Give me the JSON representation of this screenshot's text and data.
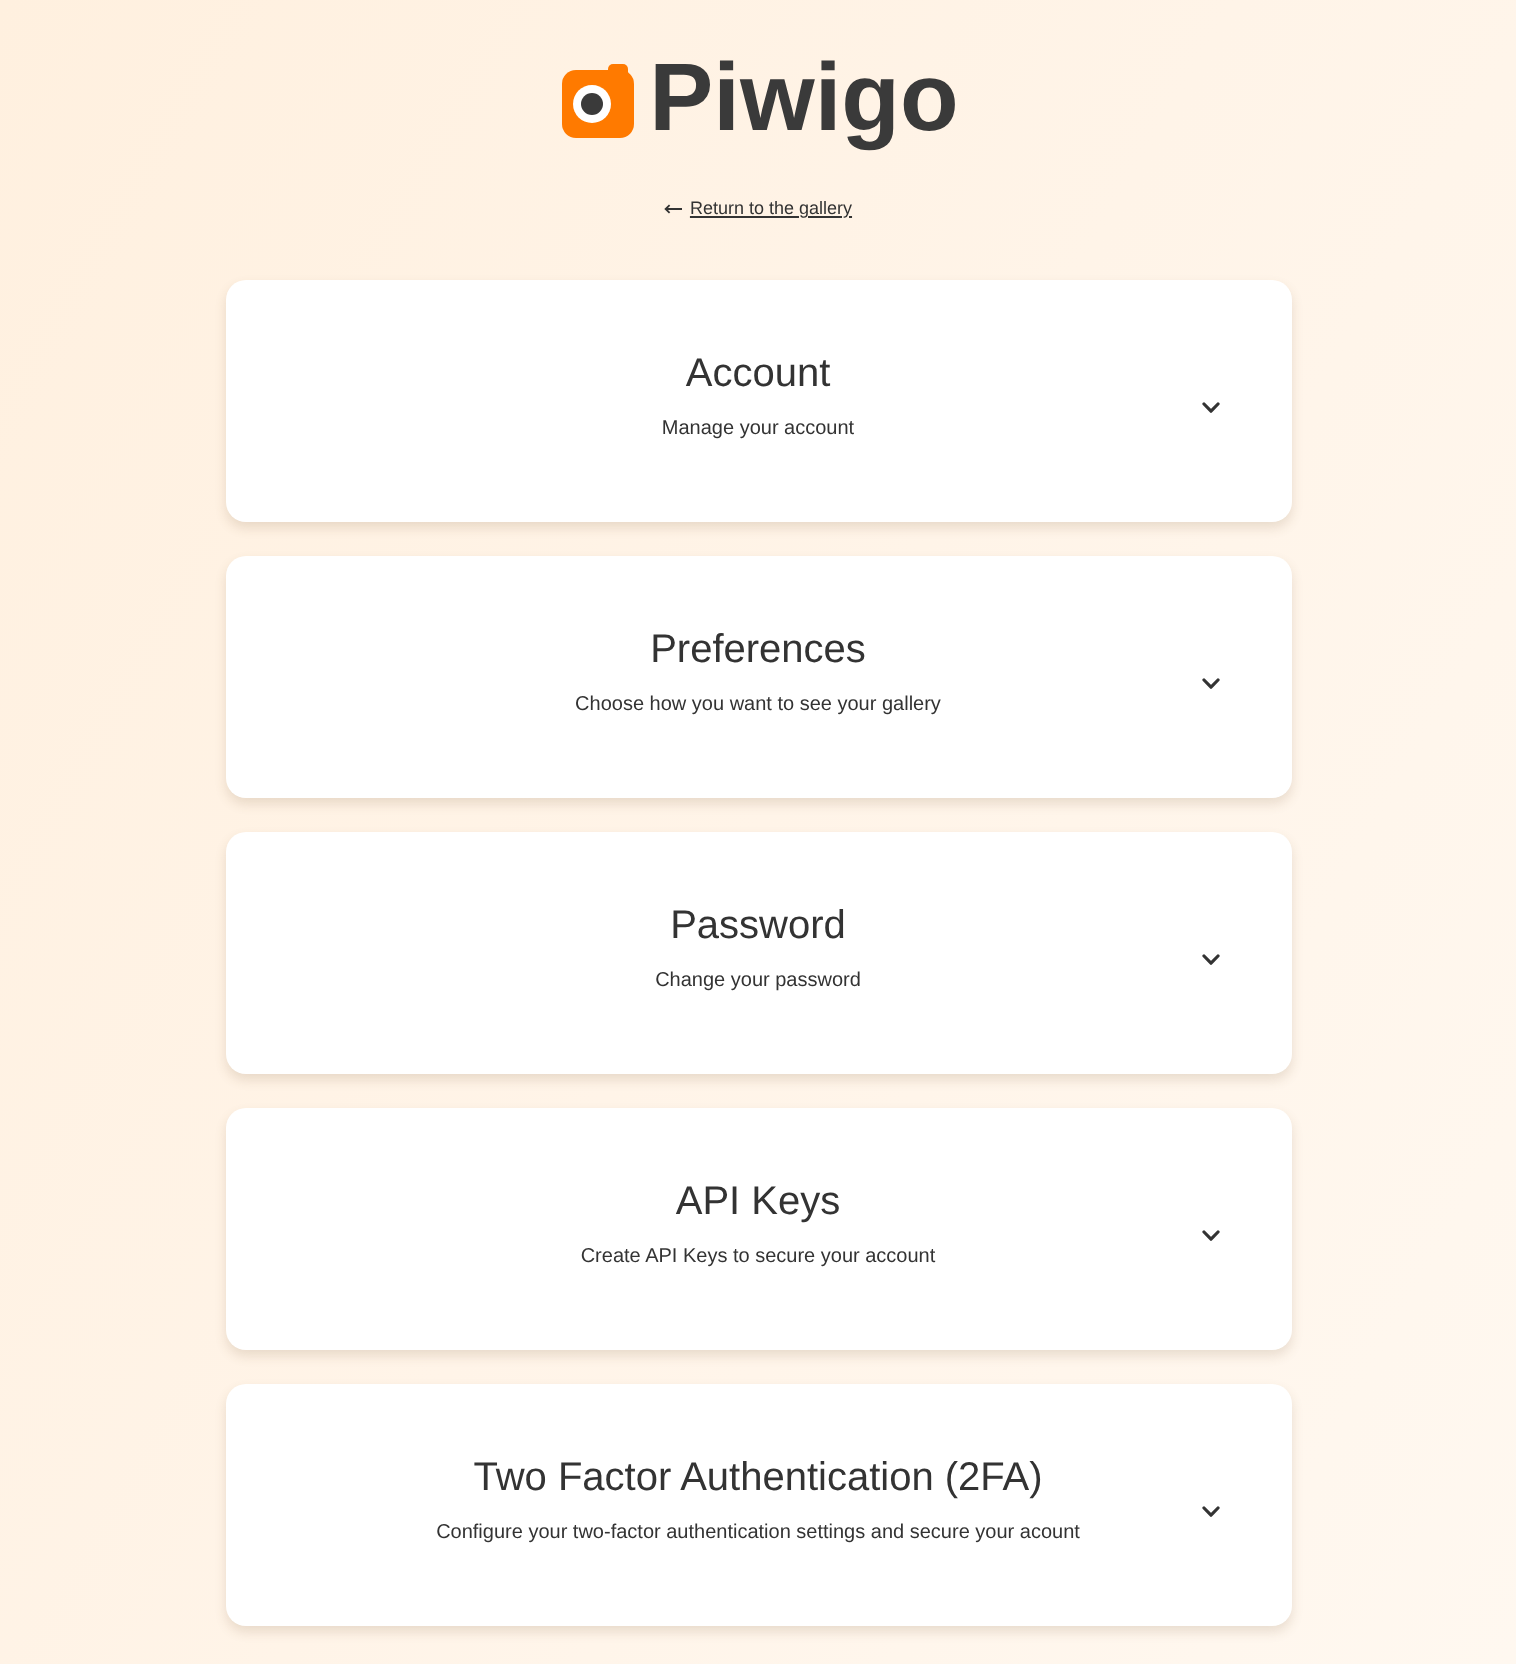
{
  "logo": {
    "text": "Piwigo"
  },
  "back_link": {
    "label": "Return to the gallery"
  },
  "sections": [
    {
      "title": "Account",
      "subtitle": "Manage your account",
      "expanded": false
    },
    {
      "title": "Preferences",
      "subtitle": "Choose how you want to see your gallery",
      "expanded": false
    },
    {
      "title": "Password",
      "subtitle": "Change your password",
      "expanded": false
    },
    {
      "title": "API Keys",
      "subtitle": "Create API Keys to secure your account",
      "expanded": false
    },
    {
      "title": "Two Factor Authentication (2FA)",
      "subtitle": "Configure your two-factor authentication settings and secure your acount",
      "expanded": false
    }
  ]
}
